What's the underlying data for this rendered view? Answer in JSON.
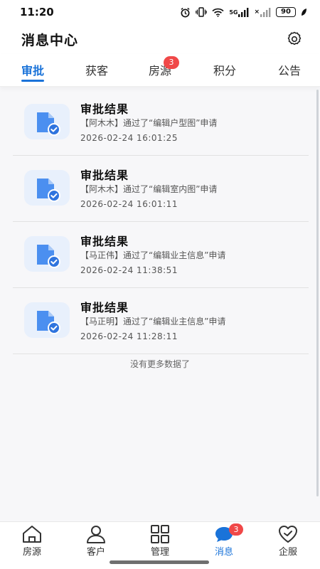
{
  "status_bar": {
    "time": "11:20",
    "signal_label": "5G",
    "signal2_label": "×",
    "battery": "90"
  },
  "header": {
    "title": "消息中心",
    "settings_icon": "gear-icon"
  },
  "tabs": [
    {
      "label": "审批",
      "active": true
    },
    {
      "label": "获客"
    },
    {
      "label": "房源",
      "badge": "3"
    },
    {
      "label": "积分"
    },
    {
      "label": "公告"
    }
  ],
  "messages": [
    {
      "title": "审批结果",
      "desc": "【阿木木】通过了“编辑户型图”申请",
      "time": "2026-02-24 16:01:25"
    },
    {
      "title": "审批结果",
      "desc": "【阿木木】通过了“编辑室内图”申请",
      "time": "2026-02-24 16:01:11"
    },
    {
      "title": "审批结果",
      "desc": "【马正伟】通过了“编辑业主信息”申请",
      "time": "2026-02-24 11:38:51"
    },
    {
      "title": "审批结果",
      "desc": "【马正明】通过了“编辑业主信息”申请",
      "time": "2026-02-24 11:28:11"
    }
  ],
  "list_footer": "没有更多数据了",
  "bottom_nav": [
    {
      "label": "房源",
      "icon": "house-icon"
    },
    {
      "label": "客户",
      "icon": "user-icon"
    },
    {
      "label": "管理",
      "icon": "grid-icon"
    },
    {
      "label": "消息",
      "icon": "chat-icon",
      "badge": "3",
      "active": true
    },
    {
      "label": "企服",
      "icon": "heart-icon"
    }
  ],
  "colors": {
    "accent": "#1a73d9",
    "badge": "#f04848"
  }
}
